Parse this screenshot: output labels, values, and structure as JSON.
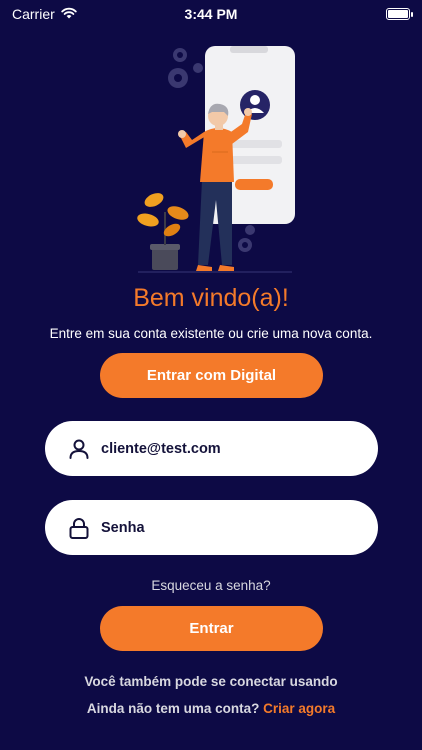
{
  "status_bar": {
    "carrier": "Carrier",
    "time": "3:44 PM"
  },
  "welcome": {
    "title": "Bem vindo(a)!",
    "subtitle": "Entre em sua conta existente ou crie uma nova conta."
  },
  "buttons": {
    "fingerprint_label": "Entrar com Digital",
    "login_label": "Entrar"
  },
  "form": {
    "email_value": "cliente@test.com",
    "password_placeholder": "Senha"
  },
  "links": {
    "forgot_password": "Esqueceu a senha?",
    "connect_with": "Você também pode se conectar usando",
    "no_account": "Ainda não tem uma conta?",
    "create_now": "Criar agora"
  },
  "icons": {
    "wifi": "wifi-icon",
    "battery": "battery-icon",
    "user": "user-icon",
    "lock": "lock-icon"
  },
  "colors": {
    "background": "#0d0a45",
    "accent": "#f47a2a",
    "field_background": "#ffffff",
    "field_text": "#14123a"
  }
}
